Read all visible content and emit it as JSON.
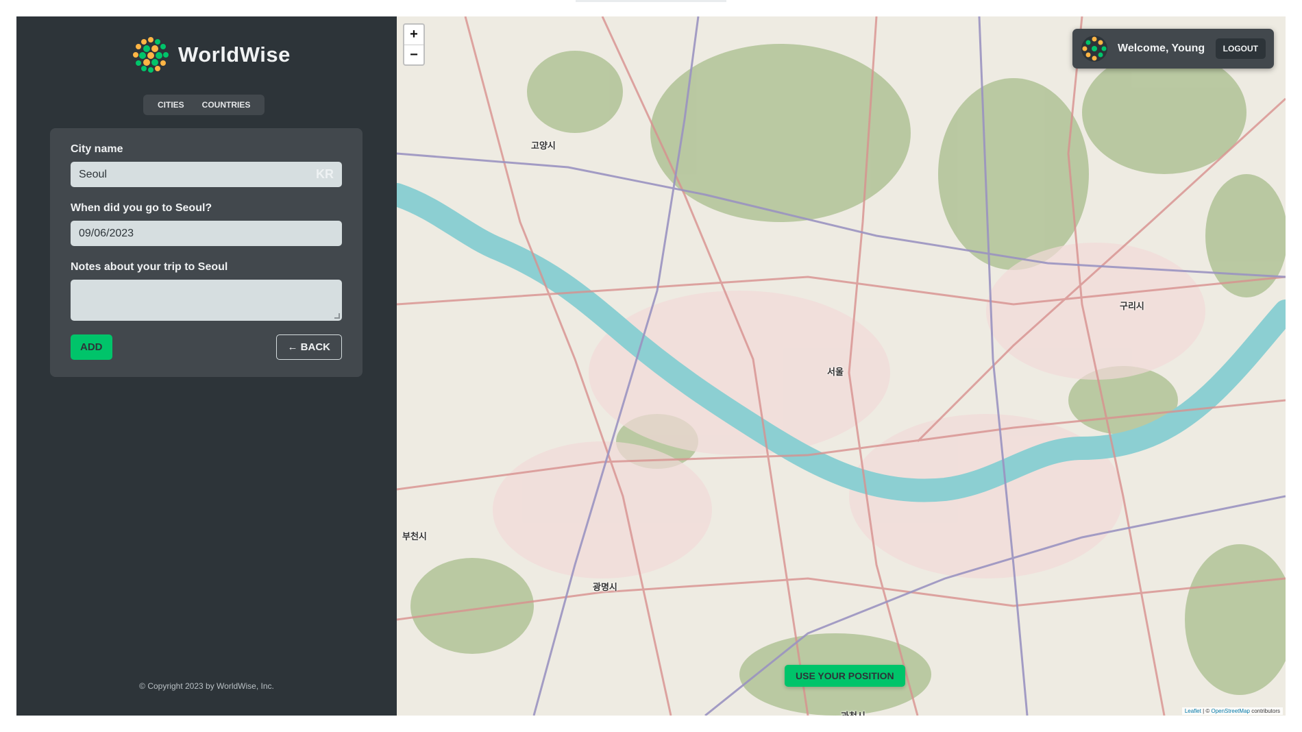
{
  "app": {
    "name": "WorldWise"
  },
  "tabs": {
    "cities": "CITIES",
    "countries": "COUNTRIES"
  },
  "form": {
    "city_label": "City name",
    "city_value": "Seoul",
    "country_code": "KR",
    "date_label": "When did you go to Seoul?",
    "date_value": "09/06/2023",
    "notes_label": "Notes about your trip to Seoul",
    "notes_value": "",
    "add_label": "ADD",
    "back_label": "← BACK"
  },
  "footer": {
    "copyright": "© Copyright 2023 by WorldWise, Inc."
  },
  "map": {
    "zoom_in": "+",
    "zoom_out": "−",
    "use_position": "USE YOUR POSITION",
    "attribution_leaflet": "Leaflet",
    "attribution_sep": " | © ",
    "attribution_osm": "OpenStreetMap",
    "attribution_tail": " contributors",
    "labels": {
      "seoul": "서울",
      "goyang": "고양시",
      "guri": "구리시",
      "bucheon": "부천시",
      "gwangmyeong": "광명시",
      "gwacheon": "과천시"
    }
  },
  "user": {
    "welcome": "Welcome, Young",
    "logout": "LOGOUT"
  },
  "colors": {
    "sidebar": "#2d3439",
    "panel": "#42484d",
    "accent": "#00c46a",
    "field": "#d6dee0",
    "river": "#8ccfd2",
    "forest": "#b4c59b"
  }
}
